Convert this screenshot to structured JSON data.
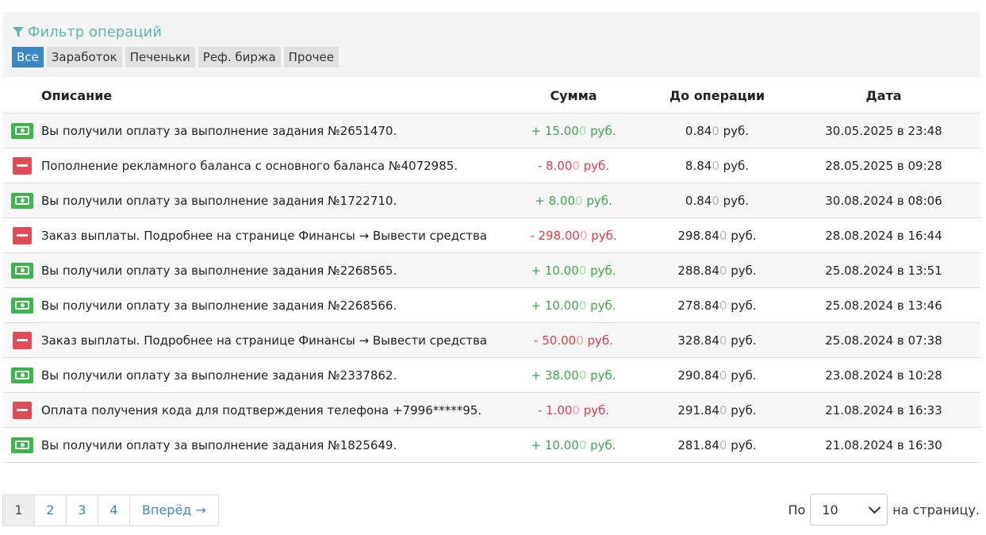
{
  "filter": {
    "title": "Фильтр операций",
    "buttons": [
      "Все",
      "Заработок",
      "Печеньки",
      "Реф. биржа",
      "Прочее"
    ],
    "active_index": 0
  },
  "table": {
    "headers": {
      "desc": "Описание",
      "sum": "Сумма",
      "before": "До операции",
      "date": "Дата"
    },
    "rows": [
      {
        "icon": "money-icon",
        "type": "pos",
        "desc": "Вы получили оплату за выполнение задания №2651470.",
        "sum_main": "+ 15.00",
        "sum_faint": "0",
        "sum_unit": " руб.",
        "before_main": "0.84",
        "before_faint": "0",
        "before_unit": " руб.",
        "date": "30.05.2025 в 23:48"
      },
      {
        "icon": "minus-icon",
        "type": "neg",
        "desc": "Пополнение рекламного баланса с основного баланса №4072985.",
        "sum_main": "- 8.00",
        "sum_faint": "0",
        "sum_unit": " руб.",
        "before_main": "8.84",
        "before_faint": "0",
        "before_unit": " руб.",
        "date": "28.05.2025 в 09:28"
      },
      {
        "icon": "money-icon",
        "type": "pos",
        "desc": "Вы получили оплату за выполнение задания №1722710.",
        "sum_main": "+ 8.00",
        "sum_faint": "0",
        "sum_unit": " руб.",
        "before_main": "0.84",
        "before_faint": "0",
        "before_unit": " руб.",
        "date": "30.08.2024 в 08:06"
      },
      {
        "icon": "minus-icon",
        "type": "neg",
        "desc": "Заказ выплаты. Подробнее на странице Финансы → Вывести средства",
        "sum_main": "- 298.00",
        "sum_faint": "0",
        "sum_unit": " руб.",
        "before_main": "298.84",
        "before_faint": "0",
        "before_unit": " руб.",
        "date": "28.08.2024 в 16:44"
      },
      {
        "icon": "money-icon",
        "type": "pos",
        "desc": "Вы получили оплату за выполнение задания №2268565.",
        "sum_main": "+ 10.00",
        "sum_faint": "0",
        "sum_unit": " руб.",
        "before_main": "288.84",
        "before_faint": "0",
        "before_unit": " руб.",
        "date": "25.08.2024 в 13:51"
      },
      {
        "icon": "money-icon",
        "type": "pos",
        "desc": "Вы получили оплату за выполнение задания №2268566.",
        "sum_main": "+ 10.00",
        "sum_faint": "0",
        "sum_unit": " руб.",
        "before_main": "278.84",
        "before_faint": "0",
        "before_unit": " руб.",
        "date": "25.08.2024 в 13:46"
      },
      {
        "icon": "minus-icon",
        "type": "neg",
        "desc": "Заказ выплаты. Подробнее на странице Финансы → Вывести средства",
        "sum_main": "- 50.00",
        "sum_faint": "0",
        "sum_unit": " руб.",
        "before_main": "328.84",
        "before_faint": "0",
        "before_unit": " руб.",
        "date": "25.08.2024 в 07:38"
      },
      {
        "icon": "money-icon",
        "type": "pos",
        "desc": "Вы получили оплату за выполнение задания №2337862.",
        "sum_main": "+ 38.00",
        "sum_faint": "0",
        "sum_unit": " руб.",
        "before_main": "290.84",
        "before_faint": "0",
        "before_unit": " руб.",
        "date": "23.08.2024 в 10:28"
      },
      {
        "icon": "minus-icon",
        "type": "neg",
        "desc": "Оплата получения кода для подтверждения телефона +7996*****95.",
        "sum_main": "- 1.00",
        "sum_faint": "0",
        "sum_unit": " руб.",
        "before_main": "291.84",
        "before_faint": "0",
        "before_unit": " руб.",
        "date": "21.08.2024 в 16:33"
      },
      {
        "icon": "money-icon",
        "type": "pos",
        "desc": "Вы получили оплату за выполнение задания №1825649.",
        "sum_main": "+ 10.00",
        "sum_faint": "0",
        "sum_unit": " руб.",
        "before_main": "281.84",
        "before_faint": "0",
        "before_unit": " руб.",
        "date": "21.08.2024 в 16:30"
      }
    ]
  },
  "pagination": {
    "pages": [
      "1",
      "2",
      "3",
      "4"
    ],
    "current": "1",
    "next_label": "Вперёд →"
  },
  "per_page": {
    "prefix": "По",
    "value": "10",
    "suffix": "на страницу."
  },
  "colors": {
    "accent": "#3a87c8",
    "positive": "#3aa84a",
    "negative": "#e03c46",
    "filter_title": "#5bb8a8"
  }
}
